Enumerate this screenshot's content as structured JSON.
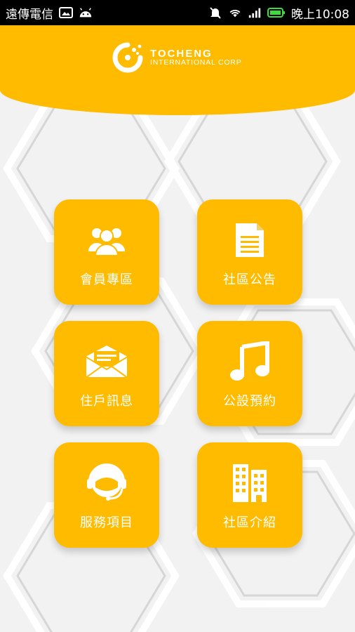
{
  "status_bar": {
    "carrier": "遠傳電信",
    "time": "晚上10:08"
  },
  "header": {
    "brand_name": "TOCHENG",
    "brand_sub": "INTERNATIONAL CORP",
    "color": "#ffbb00"
  },
  "menu": [
    {
      "label": "會員專區",
      "icon": "members-icon"
    },
    {
      "label": "社區公告",
      "icon": "document-icon"
    },
    {
      "label": "住戶訊息",
      "icon": "mail-icon"
    },
    {
      "label": "公設預約",
      "icon": "music-note-icon"
    },
    {
      "label": "服務項目",
      "icon": "support-headset-icon"
    },
    {
      "label": "社區介紹",
      "icon": "building-icon"
    }
  ]
}
